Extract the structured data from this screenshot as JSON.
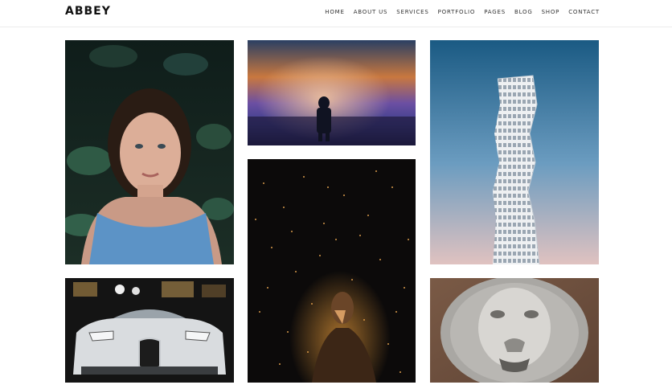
{
  "brand": "ABBEY",
  "nav": [
    "HOME",
    "ABOUT US",
    "SERVICES",
    "PORTFOLIO",
    "PAGES",
    "BLOG",
    "SHOP",
    "CONTACT"
  ],
  "gallery": [
    {
      "subject": "woman lying among leaves"
    },
    {
      "subject": "figure against colorful sunset sky"
    },
    {
      "subject": "twisting skyscraper against blue sky"
    },
    {
      "subject": "white sports car at night"
    },
    {
      "subject": "person in falling sparks"
    },
    {
      "subject": "stone lion head sculpture"
    }
  ]
}
